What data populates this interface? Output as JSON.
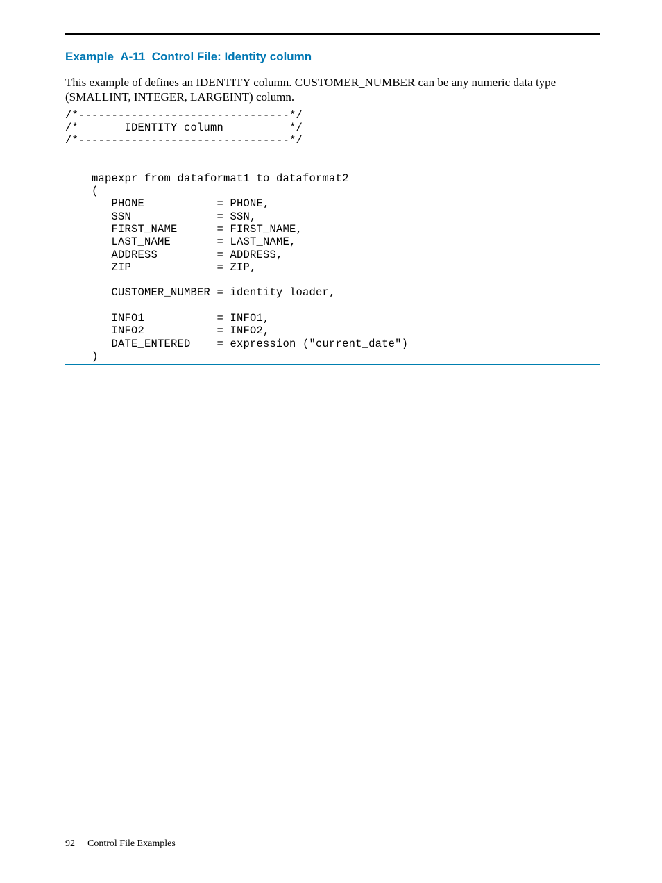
{
  "example": {
    "label_prefix": "Example  A-11  ",
    "title": "Control File: Identity column"
  },
  "description": "This example of defines an IDENTITY column. CUSTOMER_NUMBER can be any numeric data type (SMALLINT, INTEGER, LARGEINT) column.",
  "code": "/*--------------------------------*/\n/*       IDENTITY column          */\n/*--------------------------------*/\n\n\n    mapexpr from dataformat1 to dataformat2\n    (\n       PHONE           = PHONE,\n       SSN             = SSN,\n       FIRST_NAME      = FIRST_NAME,\n       LAST_NAME       = LAST_NAME,\n       ADDRESS         = ADDRESS,\n       ZIP             = ZIP,\n\n       CUSTOMER_NUMBER = identity loader,\n\n       INFO1           = INFO1,\n       INFO2           = INFO2,\n       DATE_ENTERED    = expression (\"current_date\")\n    )",
  "footer": {
    "page_number": "92",
    "section": "Control File Examples"
  }
}
